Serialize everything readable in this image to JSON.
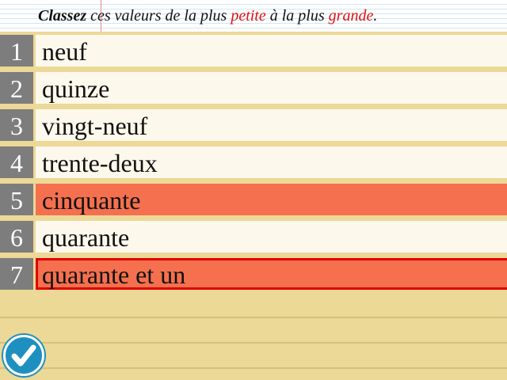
{
  "instruction": {
    "bold_word": "Classez",
    "part1": " ces valeurs de la plus ",
    "red1": "petite",
    "part2": " à la plus ",
    "red2": "grande",
    "part3": "."
  },
  "items": [
    {
      "number": "1",
      "text": "neuf",
      "state": "normal"
    },
    {
      "number": "2",
      "text": "quinze",
      "state": "normal"
    },
    {
      "number": "3",
      "text": "vingt-neuf",
      "state": "normal"
    },
    {
      "number": "4",
      "text": "trente-deux",
      "state": "normal"
    },
    {
      "number": "5",
      "text": "cinquante",
      "state": "highlighted"
    },
    {
      "number": "6",
      "text": "quarante",
      "state": "normal"
    },
    {
      "number": "7",
      "text": "quarante et un",
      "state": "highlighted-selected"
    }
  ],
  "check_button": {
    "icon": "checkmark-icon"
  },
  "colors": {
    "background": "#ecd897",
    "number_bg": "#7d7d7d",
    "cell_bg": "#fdf8ec",
    "highlight": "#f4704e",
    "selection_border": "#e00000",
    "accent_red": "#e01010",
    "check_button": "#1e90c0"
  }
}
